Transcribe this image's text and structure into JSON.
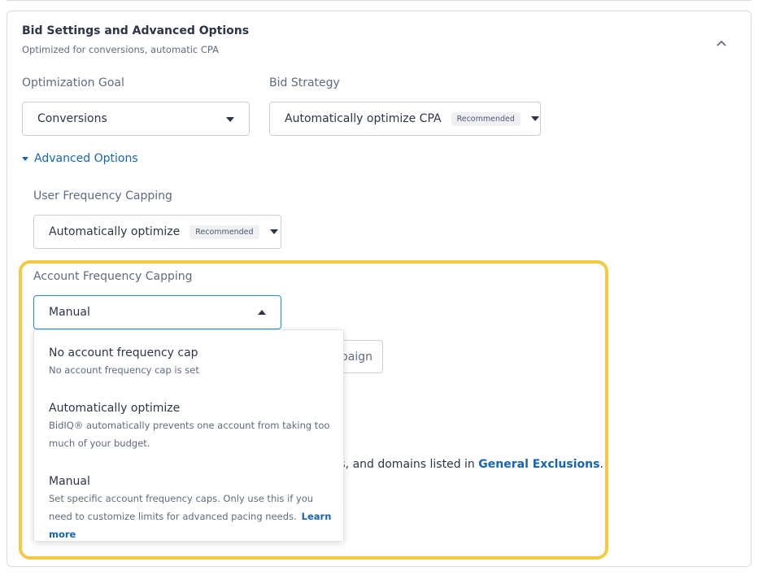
{
  "section": {
    "title": "Bid Settings and Advanced Options",
    "subtitle": "Optimized for conversions, automatic CPA"
  },
  "optimization_goal": {
    "label": "Optimization Goal",
    "value": "Conversions"
  },
  "bid_strategy": {
    "label": "Bid Strategy",
    "value": "Automatically optimize CPA",
    "badge": "Recommended"
  },
  "advanced_options": {
    "label": "Advanced Options"
  },
  "user_frequency": {
    "label": "User Frequency Capping",
    "value": "Automatically optimize",
    "badge": "Recommended"
  },
  "account_frequency": {
    "label": "Account Frequency Capping",
    "value": "Manual"
  },
  "behind": {
    "button_fragment": "paign",
    "text_fragment": "ers, and domains listed in ",
    "link": "General Exclusions",
    "period": "."
  },
  "menu": {
    "options": [
      {
        "title": "No account frequency cap",
        "desc": "No account frequency cap is set"
      },
      {
        "title": "Automatically optimize",
        "desc": "BidIQ® automatically prevents one account from taking too much of your budget."
      },
      {
        "title": "Manual",
        "desc": "Set specific account frequency caps. Only use this if you need to customize limits for advanced pacing needs.",
        "link": "Learn more"
      }
    ]
  },
  "colors": {
    "accent": "#1565b5",
    "highlight": "#f5c842"
  }
}
